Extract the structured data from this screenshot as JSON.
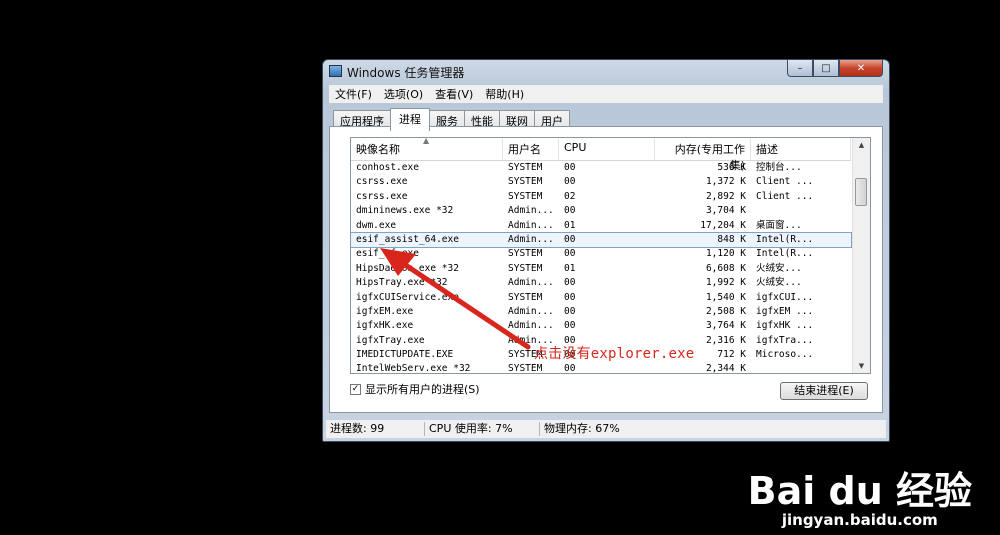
{
  "window": {
    "title": "Windows 任务管理器",
    "min_label": "–",
    "max_label": "□",
    "close_label": "✕"
  },
  "menu": [
    "文件(F)",
    "选项(O)",
    "查看(V)",
    "帮助(H)"
  ],
  "tabs": [
    "应用程序",
    "进程",
    "服务",
    "性能",
    "联网",
    "用户"
  ],
  "active_tab": "进程",
  "columns": [
    "映像名称",
    "用户名",
    "CPU",
    "内存(专用工作集)",
    "描述"
  ],
  "processes": [
    {
      "name": "conhost.exe",
      "user": "SYSTEM",
      "cpu": "00",
      "mem": "536 K",
      "desc": "控制台..."
    },
    {
      "name": "csrss.exe",
      "user": "SYSTEM",
      "cpu": "00",
      "mem": "1,372 K",
      "desc": "Client ..."
    },
    {
      "name": "csrss.exe",
      "user": "SYSTEM",
      "cpu": "02",
      "mem": "2,892 K",
      "desc": "Client ..."
    },
    {
      "name": "dmininews.exe *32",
      "user": "Admin...",
      "cpu": "00",
      "mem": "3,704 K",
      "desc": ""
    },
    {
      "name": "dwm.exe",
      "user": "Admin...",
      "cpu": "01",
      "mem": "17,204 K",
      "desc": "桌面窗..."
    },
    {
      "name": "esif_assist_64.exe",
      "user": "Admin...",
      "cpu": "00",
      "mem": "848 K",
      "desc": "Intel(R..."
    },
    {
      "name": "esif_uf.exe",
      "user": "SYSTEM",
      "cpu": "00",
      "mem": "1,120 K",
      "desc": "Intel(R..."
    },
    {
      "name": "HipsDaemon.exe *32",
      "user": "SYSTEM",
      "cpu": "01",
      "mem": "6,608 K",
      "desc": "火绒安..."
    },
    {
      "name": "HipsTray.exe *32",
      "user": "Admin...",
      "cpu": "00",
      "mem": "1,992 K",
      "desc": "火绒安..."
    },
    {
      "name": "igfxCUIService.exe",
      "user": "SYSTEM",
      "cpu": "00",
      "mem": "1,540 K",
      "desc": "igfxCUI..."
    },
    {
      "name": "igfxEM.exe",
      "user": "Admin...",
      "cpu": "00",
      "mem": "2,508 K",
      "desc": "igfxEM ..."
    },
    {
      "name": "igfxHK.exe",
      "user": "Admin...",
      "cpu": "00",
      "mem": "3,764 K",
      "desc": "igfxHK ..."
    },
    {
      "name": "igfxTray.exe",
      "user": "Admin...",
      "cpu": "00",
      "mem": "2,316 K",
      "desc": "igfxTra..."
    },
    {
      "name": "IMEDICTUPDATE.EXE",
      "user": "SYSTEM",
      "cpu": "00",
      "mem": "712 K",
      "desc": "Microso..."
    },
    {
      "name": "IntelWebServ.exe *32",
      "user": "SYSTEM",
      "cpu": "00",
      "mem": "2,344 K",
      "desc": ""
    }
  ],
  "selected_row": "esif_assist_64.exe",
  "show_all_label": "显示所有用户的进程(S)",
  "show_all_checked": "✓",
  "end_process_label": "结束进程(E)",
  "status": {
    "processes": "进程数: 99",
    "cpu": "CPU 使用率: 7%",
    "memory": "物理内存: 67%"
  },
  "annotation": "点击没有explorer.exe",
  "watermark": {
    "logo": "Bai du 经验",
    "url": "jingyan.baidu.com"
  },
  "colors": {
    "annotation": "#d9261c",
    "close_button": "#c6462c",
    "selection": "#7da2ce"
  }
}
